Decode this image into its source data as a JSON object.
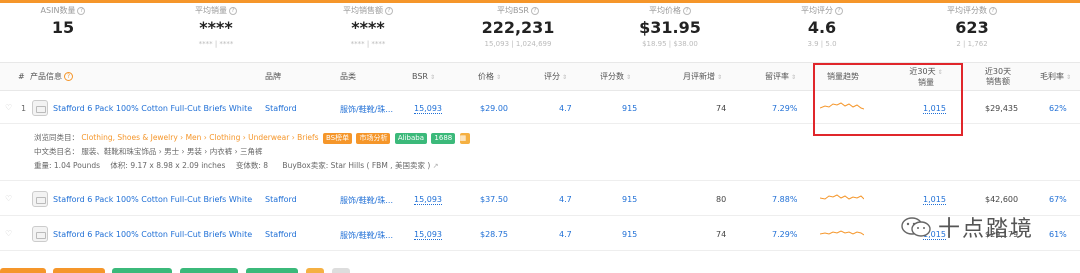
{
  "stats": [
    {
      "label": "ASIN数量",
      "value": "15",
      "sub": ""
    },
    {
      "label": "平均销量",
      "value": "****",
      "sub": "**** | ****"
    },
    {
      "label": "平均销售额",
      "value": "****",
      "sub": "**** | ****"
    },
    {
      "label": "平均BSR",
      "value": "222,231",
      "sub": "15,093 | 1,024,699"
    },
    {
      "label": "平均价格",
      "value": "$31.95",
      "sub": "$18.95 | $38.00"
    },
    {
      "label": "平均评分",
      "value": "4.6",
      "sub": "3.9 | 5.0"
    },
    {
      "label": "平均评分数",
      "value": "623",
      "sub": "2 | 1,762"
    }
  ],
  "columns": {
    "num": "#",
    "product": "产品信息",
    "brand": "品牌",
    "category": "品类",
    "bsr": "BSR",
    "price": "价格",
    "rating": "评分",
    "reviews": "评分数",
    "monthly_reviews": "月评新增",
    "review_rate": "留评率",
    "sales_trend": "销量趋势",
    "sales30_line1": "近30天",
    "sales30_line2": "销量",
    "revenue30_line1": "近30天",
    "revenue30_line2": "销售额",
    "margin": "毛利率"
  },
  "rows": [
    {
      "num": "1",
      "title": "Stafford 6 Pack 100% Cotton Full-Cut Briefs White",
      "brand": "Stafford",
      "category": "服饰/鞋靴/珠...",
      "bsr": "15,093",
      "price": "$29.00",
      "rating": "4.7",
      "reviews": "915",
      "monthly_reviews": "74",
      "review_rate": "7.29%",
      "sales30": "1,015",
      "revenue30": "$29,435",
      "margin": "62%"
    },
    {
      "num": "",
      "title": "Stafford 6 Pack 100% Cotton Full-Cut Briefs White",
      "brand": "Stafford",
      "category": "服饰/鞋靴/珠...",
      "bsr": "15,093",
      "price": "$37.50",
      "rating": "4.7",
      "reviews": "915",
      "monthly_reviews": "80",
      "review_rate": "7.88%",
      "sales30": "1,015",
      "revenue30": "$42,600",
      "margin": "67%"
    },
    {
      "num": "",
      "title": "Stafford 6 Pack 100% Cotton Full-Cut Briefs White",
      "brand": "Stafford",
      "category": "服饰/鞋靴/珠...",
      "bsr": "15,093",
      "price": "$28.75",
      "rating": "4.7",
      "reviews": "915",
      "monthly_reviews": "74",
      "review_rate": "7.29%",
      "sales30": "1,015",
      "revenue30": "$29,179",
      "margin": "61%"
    }
  ],
  "detail": {
    "browse_label": "浏览同类目：",
    "breadcrumb": [
      "Clothing, Shoes & Jewelry",
      "Men",
      "Clothing",
      "Underwear",
      "Briefs"
    ],
    "tags": [
      "BS榜单",
      "市场分析",
      "Alibaba",
      "1688"
    ],
    "cn_label": "中文类目名：",
    "cn_path": "服装、鞋靴和珠宝饰品 › 男士 › 男装 › 内衣裤 › 三角裤",
    "weight": "重量: 1.04 Pounds",
    "volume": "体积: 9.17 x 8.98 x 2.09 inches",
    "variants": "变体数: 8",
    "buybox": "BuyBox卖家: Star Hills ( FBM , 美国卖家 )"
  },
  "watermark": "十点踏境",
  "colors": {
    "accent": "#f5962a",
    "link": "#1f6fd6",
    "highlight": "#e0262b",
    "green": "#3bb97a"
  }
}
